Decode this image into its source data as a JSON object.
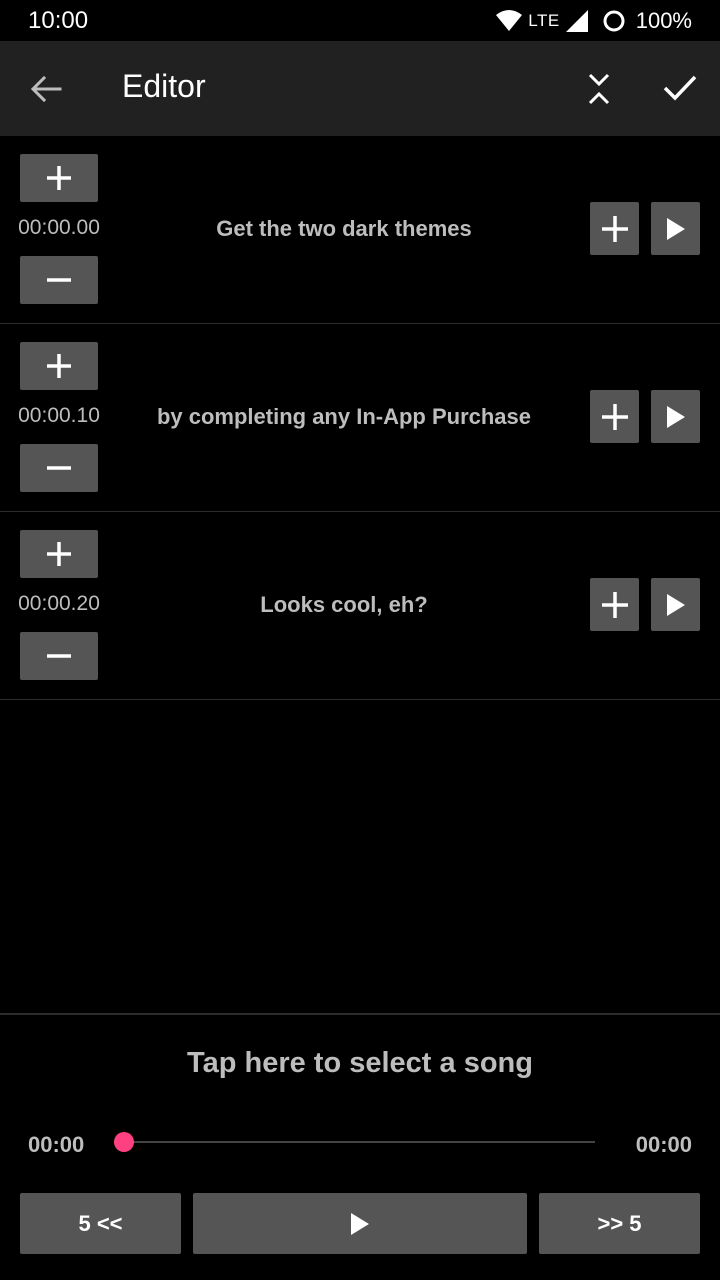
{
  "status_bar": {
    "time": "10:00",
    "network": "LTE",
    "battery": "100%"
  },
  "app_bar": {
    "title": "Editor",
    "icons": {
      "back": "arrow-back-icon",
      "collapse": "collapse-icon",
      "done": "check-icon"
    }
  },
  "rows": [
    {
      "time": "00:00.00",
      "text": "Get the two dark themes"
    },
    {
      "time": "00:00.10",
      "text": "by completing any In-App Purchase"
    },
    {
      "time": "00:00.20",
      "text": "Looks cool, eh?"
    }
  ],
  "player": {
    "song_prompt": "Tap here to select a song",
    "current_time": "00:00",
    "total_time": "00:00",
    "progress": 0,
    "rewind_label": "5 <<",
    "forward_label": ">> 5"
  },
  "colors": {
    "accent": "#ff4081",
    "button": "#555555",
    "app_bar": "#212121",
    "text_muted": "#bdbdbd"
  }
}
